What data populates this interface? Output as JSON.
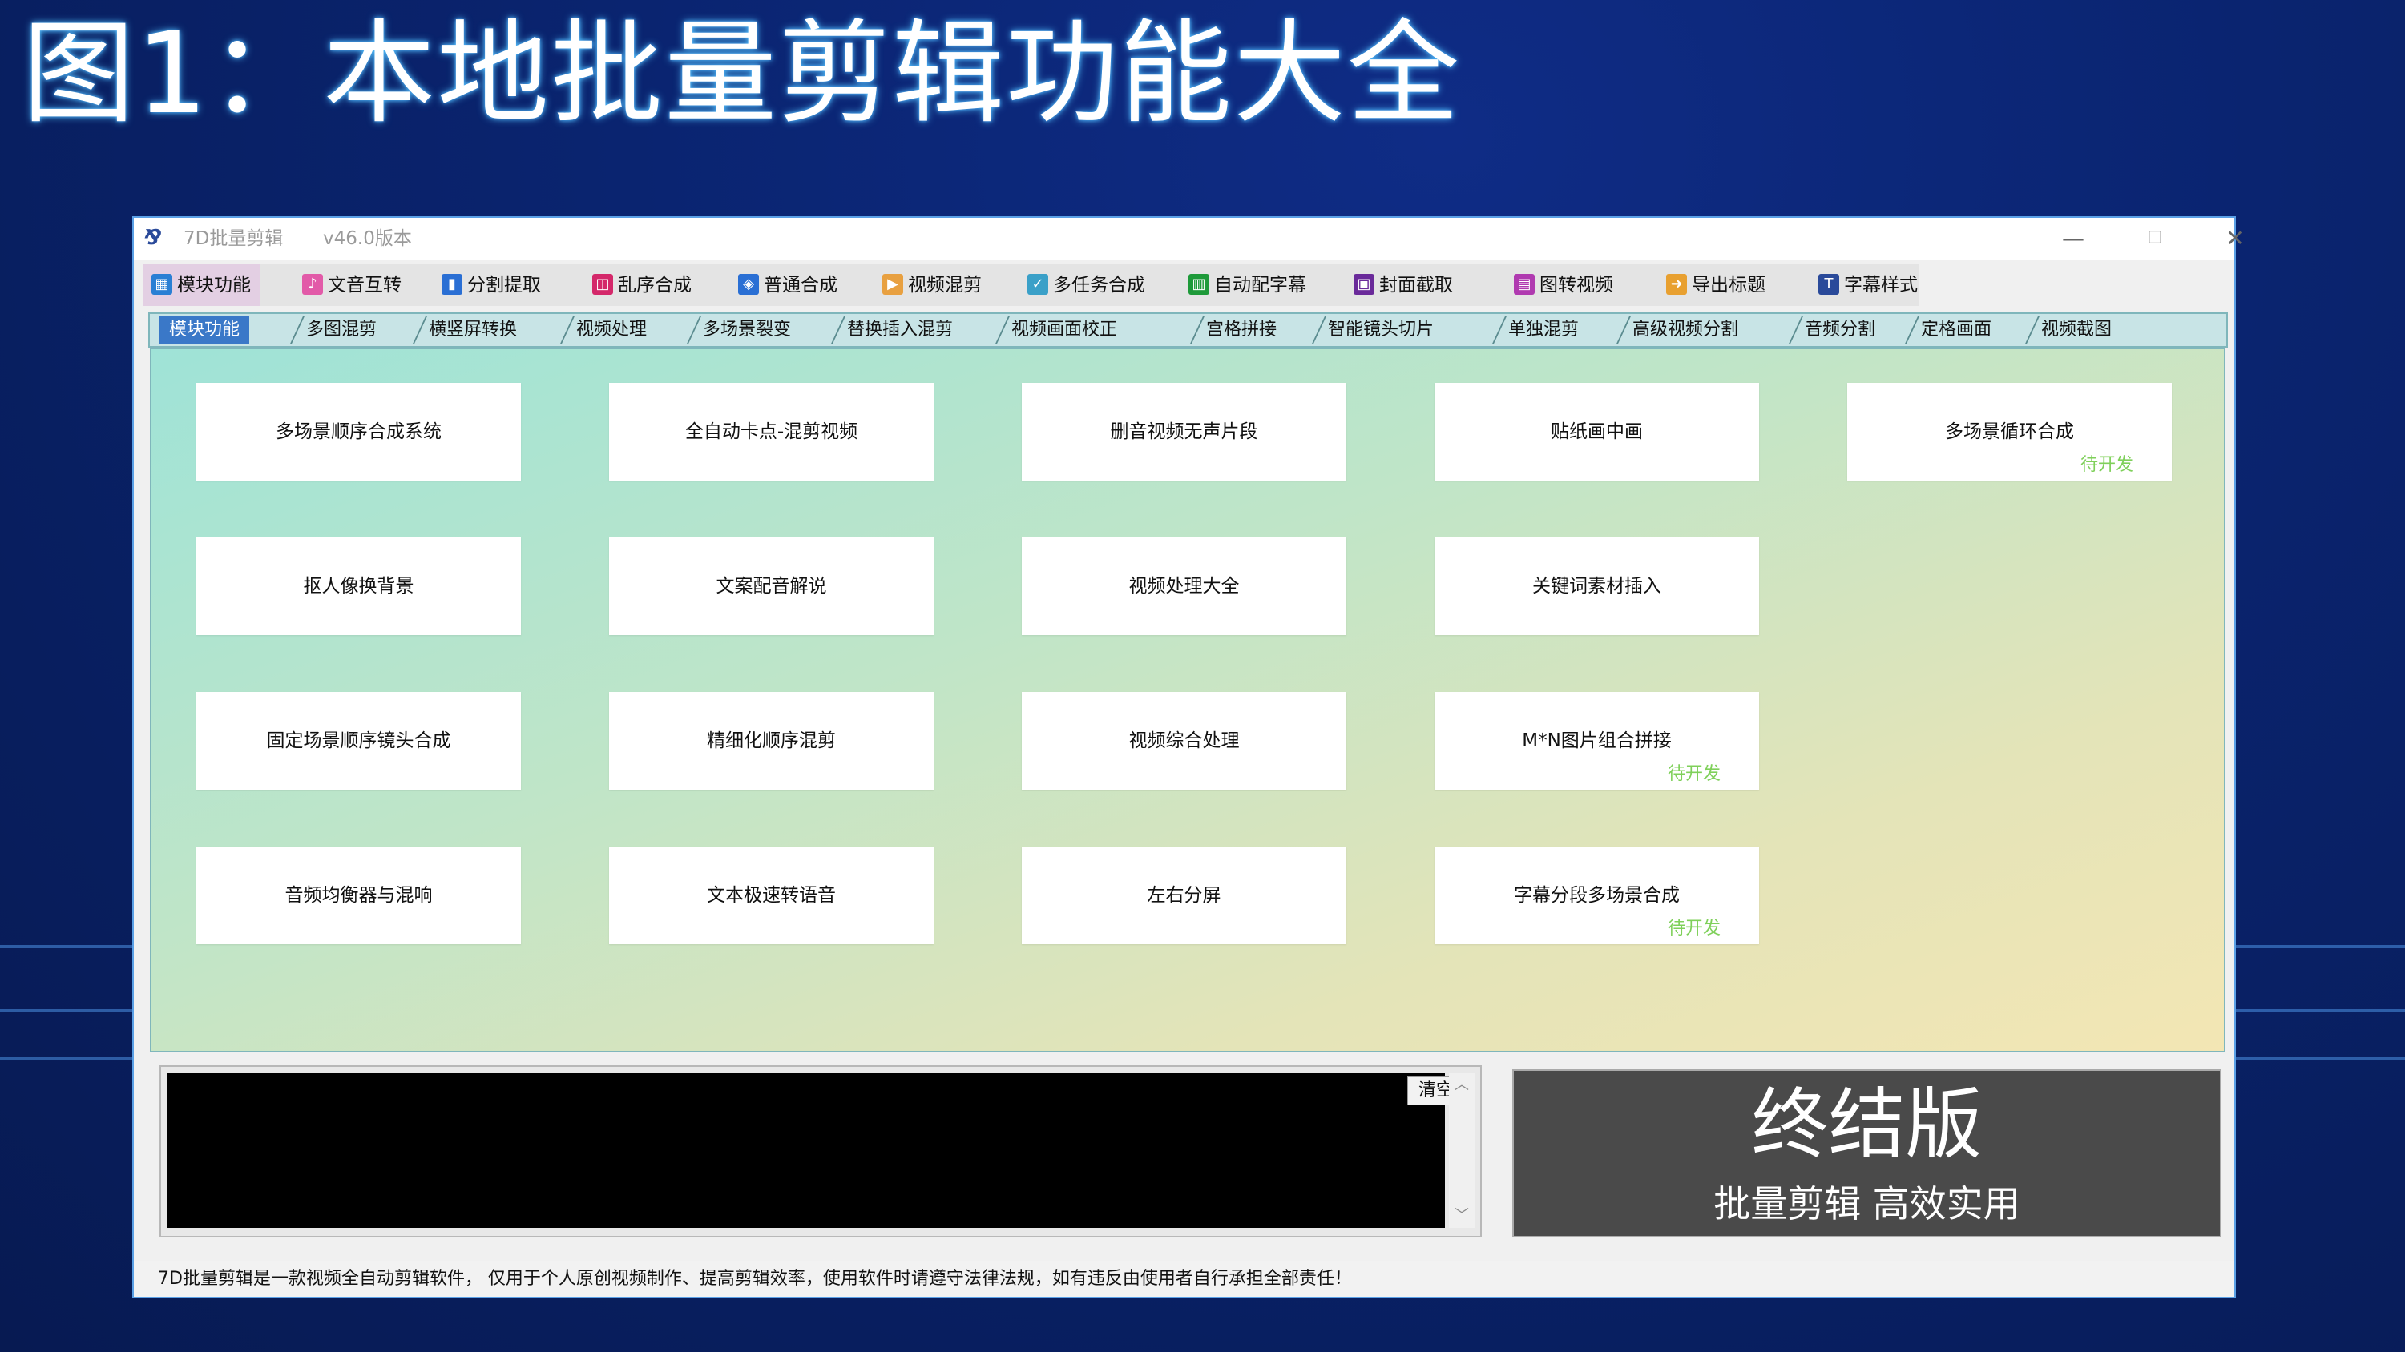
{
  "slide": {
    "heading": "图1：本地批量剪辑功能大全"
  },
  "window": {
    "title": "7D批量剪辑",
    "version": "v46.0版本",
    "controls": {
      "minimize": "—",
      "maximize": "☐",
      "close": "✕"
    }
  },
  "toolbar": {
    "items": [
      {
        "label": "模块功能",
        "icon": "grid-icon",
        "color": "#2a7fd4",
        "active": true
      },
      {
        "label": "文音互转",
        "icon": "text-audio-icon",
        "color": "#e25aa8"
      },
      {
        "label": "分割提取",
        "icon": "split-icon",
        "color": "#2a6fd4"
      },
      {
        "label": "乱序合成",
        "icon": "shuffle-icon",
        "color": "#d4286a"
      },
      {
        "label": "普通合成",
        "icon": "layers-icon",
        "color": "#2a6fd4"
      },
      {
        "label": "视频混剪",
        "icon": "video-mix-icon",
        "color": "#e8a040"
      },
      {
        "label": "多任务合成",
        "icon": "multitask-icon",
        "color": "#3aa0c8"
      },
      {
        "label": "自动配字幕",
        "icon": "subtitle-icon",
        "color": "#1e9a3a"
      },
      {
        "label": "封面截取",
        "icon": "cover-icon",
        "color": "#6a2a9a"
      },
      {
        "label": "图转视频",
        "icon": "image-video-icon",
        "color": "#b03ab0"
      },
      {
        "label": "导出标题",
        "icon": "export-icon",
        "color": "#e8a030"
      },
      {
        "label": "字幕样式",
        "icon": "text-style-icon",
        "color": "#2a4a9a"
      }
    ]
  },
  "tabs": [
    {
      "label": "模块功能",
      "active": true
    },
    {
      "label": "多图混剪"
    },
    {
      "label": "横竖屏转换"
    },
    {
      "label": "视频处理"
    },
    {
      "label": "多场景裂变"
    },
    {
      "label": "替换插入混剪"
    },
    {
      "label": "视频画面校正"
    },
    {
      "label": "宫格拼接"
    },
    {
      "label": "智能镜头切片"
    },
    {
      "label": "单独混剪"
    },
    {
      "label": "高级视频分割"
    },
    {
      "label": "音频分割"
    },
    {
      "label": "定格画面"
    },
    {
      "label": "视频截图"
    }
  ],
  "modules": [
    {
      "label": "多场景顺序合成系统"
    },
    {
      "label": "全自动卡点-混剪视频"
    },
    {
      "label": "删音视频无声片段"
    },
    {
      "label": "贴纸画中画"
    },
    {
      "label": "多场景循环合成",
      "badge": "待开发"
    },
    {
      "label": "抠人像换背景"
    },
    {
      "label": "文案配音解说"
    },
    {
      "label": "视频处理大全"
    },
    {
      "label": "关键词素材插入"
    },
    {
      "label": "固定场景顺序镜头合成"
    },
    {
      "label": "精细化顺序混剪"
    },
    {
      "label": "视频综合处理"
    },
    {
      "label": "M*N图片组合拼接",
      "badge": "待开发"
    },
    {
      "label": "音频均衡器与混响"
    },
    {
      "label": "文本极速转语音"
    },
    {
      "label": "左右分屏"
    },
    {
      "label": "字幕分段多场景合成",
      "badge": "待开发"
    }
  ],
  "log": {
    "clear_label": "清空",
    "scroll_up": "︿",
    "scroll_down": "﹀"
  },
  "promo": {
    "title": "终结版",
    "subtitle": "批量剪辑 高效实用"
  },
  "statusbar": {
    "text": "7D批量剪辑是一款视频全自动剪辑软件，  仅用于个人原创视频制作、提高剪辑效率，使用软件时请遵守法律法规，如有违反由使用者自行承担全部责任！"
  }
}
